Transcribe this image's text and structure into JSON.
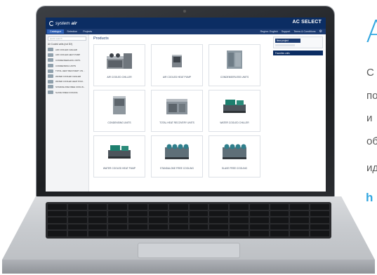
{
  "app": {
    "brand_prefix": "system",
    "brand_bold": "air",
    "title": "AC SELECT",
    "nav_tabs": [
      "Catalogue",
      "Selection",
      "Projects"
    ],
    "nav_right": [
      "Region: English",
      "Support",
      "Terms & Conditions"
    ],
    "search_placeholder": "Quick search",
    "sidebar_heading": "Air Cooled units (not DX)",
    "sidebar_items": [
      "AIR COOLED CHILLER",
      "AIR COOLED HEAT PUMP",
      "CONDENSERLESS UNITS",
      "CONDENSING UNITS",
      "TOTAL HEAT RECOVERY UN...",
      "WATER COOLED CHILLER",
      "WATER COOLED HEAT PUM...",
      "STANDALONE FREE COOLIN...",
      "SLAVE FREE COOLING"
    ],
    "main_title": "Products",
    "products": [
      "AIR COOLED CHILLER",
      "AIR COOLED HEAT PUMP",
      "CONDENSERLESS UNITS",
      "CONDENSING UNITS",
      "TOTAL HEAT RECOVERY UNITS",
      "WATER COOLED CHILLER",
      "WATER COOLED HEAT PUMP",
      "STANDALONE FREE COOLING",
      "SLAVE FREE COOLING"
    ],
    "project_button": "New project",
    "unit_bar": "Favorites units"
  },
  "marketing": {
    "heading_letter": "A",
    "lines": [
      "С",
      "по",
      "и",
      "об",
      "ид"
    ],
    "link_letter": "h"
  },
  "colors": {
    "header": "#0b2d63",
    "accent": "#34a7e0"
  }
}
